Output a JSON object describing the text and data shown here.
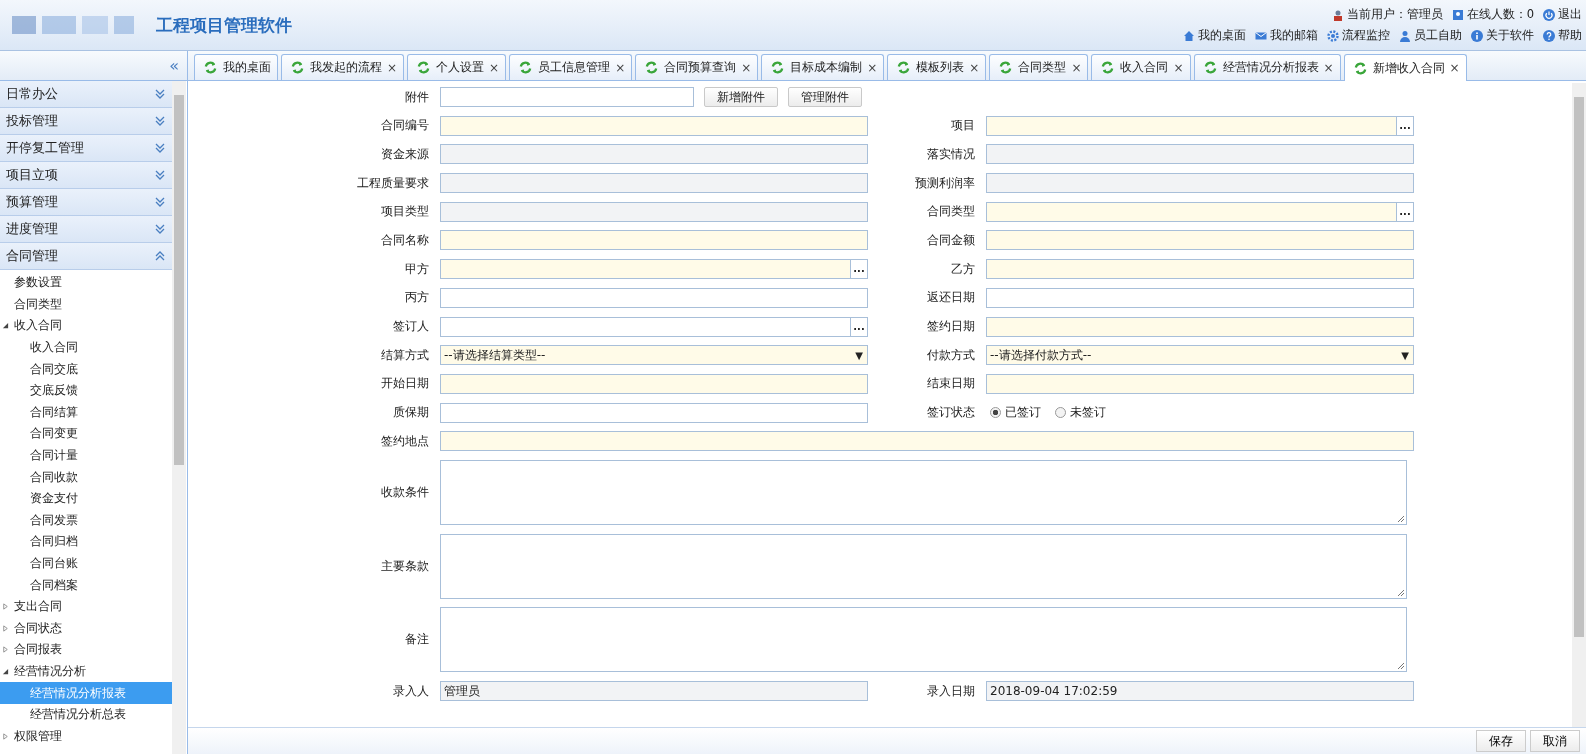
{
  "header": {
    "title": "工程项目管理软件",
    "current_user": "当前用户：管理员",
    "online": "在线人数：0",
    "logout": "退出",
    "links": [
      "我的桌面",
      "我的邮箱",
      "流程监控",
      "员工自助",
      "关于软件",
      "帮助"
    ]
  },
  "sidebar": {
    "collapse": "«",
    "groups": [
      {
        "label": "日常办公",
        "expanded": false
      },
      {
        "label": "投标管理",
        "expanded": false
      },
      {
        "label": "开停复工管理",
        "expanded": false
      },
      {
        "label": "项目立项",
        "expanded": false
      },
      {
        "label": "预算管理",
        "expanded": false
      },
      {
        "label": "进度管理",
        "expanded": false
      },
      {
        "label": "合同管理",
        "expanded": true
      }
    ],
    "tree": [
      {
        "label": "参数设置",
        "selected": false
      },
      {
        "label": "合同类型",
        "selected": false
      },
      {
        "label": "收入合同",
        "selected": false,
        "expanded": true,
        "children": [
          {
            "label": "收入合同",
            "selected": false
          },
          {
            "label": "合同交底",
            "selected": false
          },
          {
            "label": "交底反馈",
            "selected": false
          },
          {
            "label": "合同结算",
            "selected": false
          },
          {
            "label": "合同变更",
            "selected": false
          },
          {
            "label": "合同计量",
            "selected": false
          },
          {
            "label": "合同收款",
            "selected": false
          },
          {
            "label": "资金支付",
            "selected": false
          },
          {
            "label": "合同发票",
            "selected": false
          },
          {
            "label": "合同归档",
            "selected": false
          },
          {
            "label": "合同台账",
            "selected": false
          },
          {
            "label": "合同档案",
            "selected": false
          }
        ]
      },
      {
        "label": "支出合同",
        "selected": false,
        "expanded": false
      },
      {
        "label": "合同状态",
        "selected": false,
        "expanded": false
      },
      {
        "label": "合同报表",
        "selected": false,
        "expanded": false
      },
      {
        "label": "经营情况分析",
        "selected": false,
        "expanded": true,
        "children": [
          {
            "label": "经营情况分析报表",
            "selected": true
          },
          {
            "label": "经营情况分析总表",
            "selected": false
          }
        ]
      },
      {
        "label": "权限管理",
        "selected": false,
        "expanded": false
      }
    ]
  },
  "tabs": [
    {
      "label": "我的桌面",
      "closable": false,
      "selected": false
    },
    {
      "label": "我发起的流程",
      "closable": true,
      "selected": false
    },
    {
      "label": "个人设置",
      "closable": true,
      "selected": false
    },
    {
      "label": "员工信息管理",
      "closable": true,
      "selected": false
    },
    {
      "label": "合同预算查询",
      "closable": true,
      "selected": false
    },
    {
      "label": "目标成本编制",
      "closable": true,
      "selected": false
    },
    {
      "label": "模板列表",
      "closable": true,
      "selected": false
    },
    {
      "label": "合同类型",
      "closable": true,
      "selected": false
    },
    {
      "label": "收入合同",
      "closable": true,
      "selected": false
    },
    {
      "label": "经营情况分析报表",
      "closable": true,
      "selected": false
    },
    {
      "label": "新增收入合同",
      "closable": true,
      "selected": true
    }
  ],
  "close_mark": "×",
  "form": {
    "rows": [
      {
        "cells": [
          {
            "label": "附件",
            "kind": "file",
            "required": false,
            "readonly": false,
            "buttons": [
              "新增附件",
              "管理附件"
            ]
          }
        ]
      },
      {
        "cells": [
          {
            "label": "合同编号",
            "kind": "text",
            "required": true,
            "readonly": false
          },
          {
            "label": "项目",
            "kind": "text",
            "required": true,
            "readonly": false,
            "picker": "..."
          }
        ]
      },
      {
        "cells": [
          {
            "label": "资金来源",
            "kind": "text",
            "readonly": true
          },
          {
            "label": "落实情况",
            "kind": "text",
            "readonly": true
          }
        ]
      },
      {
        "cells": [
          {
            "label": "工程质量要求",
            "kind": "text",
            "readonly": true
          },
          {
            "label": "预测利润率",
            "kind": "text",
            "readonly": true
          }
        ]
      },
      {
        "cells": [
          {
            "label": "项目类型",
            "kind": "text",
            "readonly": true
          },
          {
            "label": "合同类型",
            "kind": "text",
            "required": true,
            "readonly": false,
            "picker": "..."
          }
        ]
      },
      {
        "cells": [
          {
            "label": "合同名称",
            "kind": "text",
            "required": true,
            "readonly": false
          },
          {
            "label": "合同金额",
            "kind": "text",
            "required": true,
            "readonly": false
          }
        ]
      },
      {
        "cells": [
          {
            "label": "甲方",
            "kind": "text",
            "required": true,
            "readonly": false,
            "picker": "..."
          },
          {
            "label": "乙方",
            "kind": "text",
            "required": true,
            "readonly": false
          }
        ]
      },
      {
        "cells": [
          {
            "label": "丙方",
            "kind": "text",
            "required": false,
            "readonly": false
          },
          {
            "label": "返还日期",
            "kind": "text",
            "required": false,
            "readonly": false
          }
        ]
      },
      {
        "cells": [
          {
            "label": "签订人",
            "kind": "text",
            "required": false,
            "readonly": false,
            "picker": "..."
          },
          {
            "label": "签约日期",
            "kind": "text",
            "required": true,
            "readonly": false
          }
        ]
      },
      {
        "cells": [
          {
            "label": "结算方式",
            "kind": "select",
            "required": true,
            "readonly": false,
            "value": "--请选择结算类型--",
            "arrow": "▼"
          },
          {
            "label": "付款方式",
            "kind": "select",
            "required": true,
            "readonly": false,
            "value": "--请选择付款方式--",
            "arrow": "▼"
          }
        ]
      },
      {
        "cells": [
          {
            "label": "开始日期",
            "kind": "text",
            "required": true,
            "readonly": false
          },
          {
            "label": "结束日期",
            "kind": "text",
            "required": true,
            "readonly": false
          }
        ]
      },
      {
        "cells": [
          {
            "label": "质保期",
            "kind": "text",
            "required": false,
            "readonly": false
          },
          {
            "label": "签订状态",
            "kind": "radio",
            "options": [
              {
                "label": "已签订",
                "selected": true
              },
              {
                "label": "未签订",
                "selected": false
              }
            ]
          }
        ]
      },
      {
        "cells": [
          {
            "label": "签约地点",
            "kind": "wide",
            "required": true,
            "readonly": false
          }
        ]
      },
      {
        "cells": [
          {
            "label": "收款条件",
            "kind": "textarea",
            "required": false,
            "readonly": false
          }
        ]
      },
      {
        "cells": [
          {
            "label": "主要条款",
            "kind": "textarea",
            "required": false,
            "readonly": false
          }
        ]
      },
      {
        "cells": [
          {
            "label": "备注",
            "kind": "textarea",
            "required": false,
            "readonly": false
          }
        ]
      },
      {
        "cells": [
          {
            "label": "录入人",
            "kind": "text",
            "readonly": true,
            "value": "管理员"
          },
          {
            "label": "录入日期",
            "kind": "text",
            "readonly": true,
            "value": "2018-09-04 17:02:59"
          }
        ]
      }
    ]
  },
  "footer": {
    "buttons": [
      "保存",
      "取消"
    ]
  }
}
